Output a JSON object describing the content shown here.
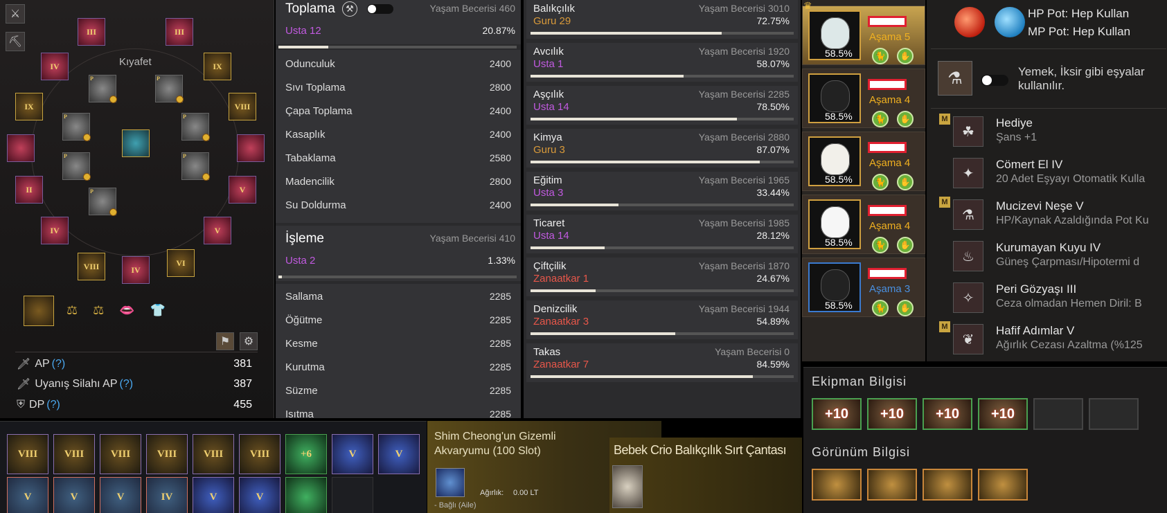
{
  "equipment": {
    "outfit_label": "Kıyafet",
    "slots_roman": [
      "III",
      "III",
      "IV",
      "IX",
      "IX",
      "VIII",
      "II",
      "V",
      "IV",
      "V",
      "VIII",
      "VI",
      "IV"
    ],
    "stats": [
      {
        "label": "AP",
        "q": "(?)",
        "value": "381",
        "icon": "sword-icon"
      },
      {
        "label": "Uyanış Silahı AP",
        "q": "(?)",
        "value": "387",
        "icon": "sword-icon"
      },
      {
        "label": "DP",
        "q": "(?)",
        "value": "455",
        "icon": "shield-icon"
      }
    ]
  },
  "gathering": {
    "title": "Toplama",
    "life_label": "Yaşam Becerisi 460",
    "rank": "Usta 12",
    "percent": "20.87%",
    "progress": 0.2087,
    "skills": [
      {
        "name": "Odunculuk",
        "value": "2400"
      },
      {
        "name": "Sıvı Toplama",
        "value": "2800"
      },
      {
        "name": "Çapa Toplama",
        "value": "2400"
      },
      {
        "name": "Kasaplık",
        "value": "2400"
      },
      {
        "name": "Tabaklama",
        "value": "2580"
      },
      {
        "name": "Madencilik",
        "value": "2800"
      },
      {
        "name": "Su Doldurma",
        "value": "2400"
      }
    ]
  },
  "processing": {
    "title": "İşleme",
    "life_label": "Yaşam Becerisi 410",
    "rank": "Usta 2",
    "percent": "1.33%",
    "progress": 0.0133,
    "skills": [
      {
        "name": "Sallama",
        "value": "2285"
      },
      {
        "name": "Öğütme",
        "value": "2285"
      },
      {
        "name": "Kesme",
        "value": "2285"
      },
      {
        "name": "Kurutma",
        "value": "2285"
      },
      {
        "name": "Süzme",
        "value": "2285"
      },
      {
        "name": "Isıtma",
        "value": "2285"
      }
    ]
  },
  "life_skills": [
    {
      "name": "Balıkçılık",
      "level": "Yaşam Becerisi 3010",
      "rank": "Guru 29",
      "rank_color": "orange",
      "pct": "72.75%",
      "progress": 0.7275
    },
    {
      "name": "Avcılık",
      "level": "Yaşam Becerisi 1920",
      "rank": "Usta 1",
      "rank_color": "purple",
      "pct": "58.07%",
      "progress": 0.5807
    },
    {
      "name": "Aşçılık",
      "level": "Yaşam Becerisi 2285",
      "rank": "Usta 14",
      "rank_color": "purple",
      "pct": "78.50%",
      "progress": 0.785
    },
    {
      "name": "Kimya",
      "level": "Yaşam Becerisi 2880",
      "rank": "Guru 3",
      "rank_color": "orange",
      "pct": "87.07%",
      "progress": 0.8707
    },
    {
      "name": "Eğitim",
      "level": "Yaşam Becerisi 1965",
      "rank": "Usta 3",
      "rank_color": "purple",
      "pct": "33.44%",
      "progress": 0.3344
    },
    {
      "name": "Ticaret",
      "level": "Yaşam Becerisi 1985",
      "rank": "Usta 14",
      "rank_color": "purple",
      "pct": "28.12%",
      "progress": 0.2812
    },
    {
      "name": "Çiftçilik",
      "level": "Yaşam Becerisi 1870",
      "rank": "Zanaatkar 1",
      "rank_color": "red",
      "pct": "24.67%",
      "progress": 0.2467
    },
    {
      "name": "Denizcilik",
      "level": "Yaşam Becerisi 1944",
      "rank": "Zanaatkar 3",
      "rank_color": "red",
      "pct": "54.89%",
      "progress": 0.5489
    },
    {
      "name": "Takas",
      "level": "Yaşam Becerisi 0",
      "rank": "Zanaatkar 7",
      "rank_color": "red",
      "pct": "84.59%",
      "progress": 0.8459
    }
  ],
  "pets": [
    {
      "stage": "Aşama 5",
      "pct": "58.5%",
      "kind": "gold"
    },
    {
      "stage": "Aşama 4",
      "pct": "58.5%",
      "kind": "gold"
    },
    {
      "stage": "Aşama 4",
      "pct": "58.5%",
      "kind": "gold"
    },
    {
      "stage": "Aşama 4",
      "pct": "58.5%",
      "kind": "gold"
    },
    {
      "stage": "Aşama 3",
      "pct": "58.5%",
      "kind": "blue"
    }
  ],
  "pots": {
    "hp": "HP Pot: Hep Kullan",
    "mp": "MP Pot: Hep Kullan"
  },
  "food_text_1": "Yemek, İksir gibi eşyalar",
  "food_text_2": "kullanılır.",
  "buffs": [
    {
      "title": "Hediye",
      "desc": "Şans +1",
      "icon": "clover-icon",
      "m": true
    },
    {
      "title": "Cömert El IV",
      "desc": "20 Adet Eşyayı Otomatik Kulla",
      "icon": "fairy-icon",
      "m": false
    },
    {
      "title": "Mucizevi Neşe V",
      "desc": "HP/Kaynak Azaldığında Pot Ku",
      "icon": "potion-icon",
      "m": true
    },
    {
      "title": "Kurumayan Kuyu IV",
      "desc": "Güneş Çarpması/Hipotermi d",
      "icon": "bowl-icon",
      "m": false
    },
    {
      "title": "Peri Gözyaşı III",
      "desc": "Ceza olmadan Hemen Diril: B",
      "icon": "tear-icon",
      "m": false
    },
    {
      "title": "Hafif Adımlar V",
      "desc": "Ağırlık Cezası Azaltma (%125",
      "icon": "feather-icon",
      "m": true
    }
  ],
  "inventory_row1": [
    "VIII",
    "VIII",
    "VIII",
    "VIII",
    "VIII",
    "VIII",
    "+6",
    "V",
    "V"
  ],
  "inventory_row2": [
    "V",
    "V",
    "V",
    "IV",
    "V",
    "V",
    "",
    ""
  ],
  "aquarium": {
    "title": "Shim Cheong'un Gizemli Akvaryumu (100 Slot)",
    "weight_label": "Ağırlık:",
    "weight_value": "0.00 LT",
    "bound": "- Bağlı (Aile)"
  },
  "backpack": {
    "title": "Bebek Crio Balıkçılık Sırt Çantası"
  },
  "gear_info": {
    "equip_title": "Ekipman Bilgisi",
    "equip_slots": [
      "+10",
      "+10",
      "+10",
      "+10",
      "",
      ""
    ],
    "cosmetic_title": "Görünüm Bilgisi"
  },
  "colors": {
    "purple": "#c15ae0",
    "orange": "#d99a3a",
    "red": "#e8574a",
    "gold": "#f0b020"
  }
}
